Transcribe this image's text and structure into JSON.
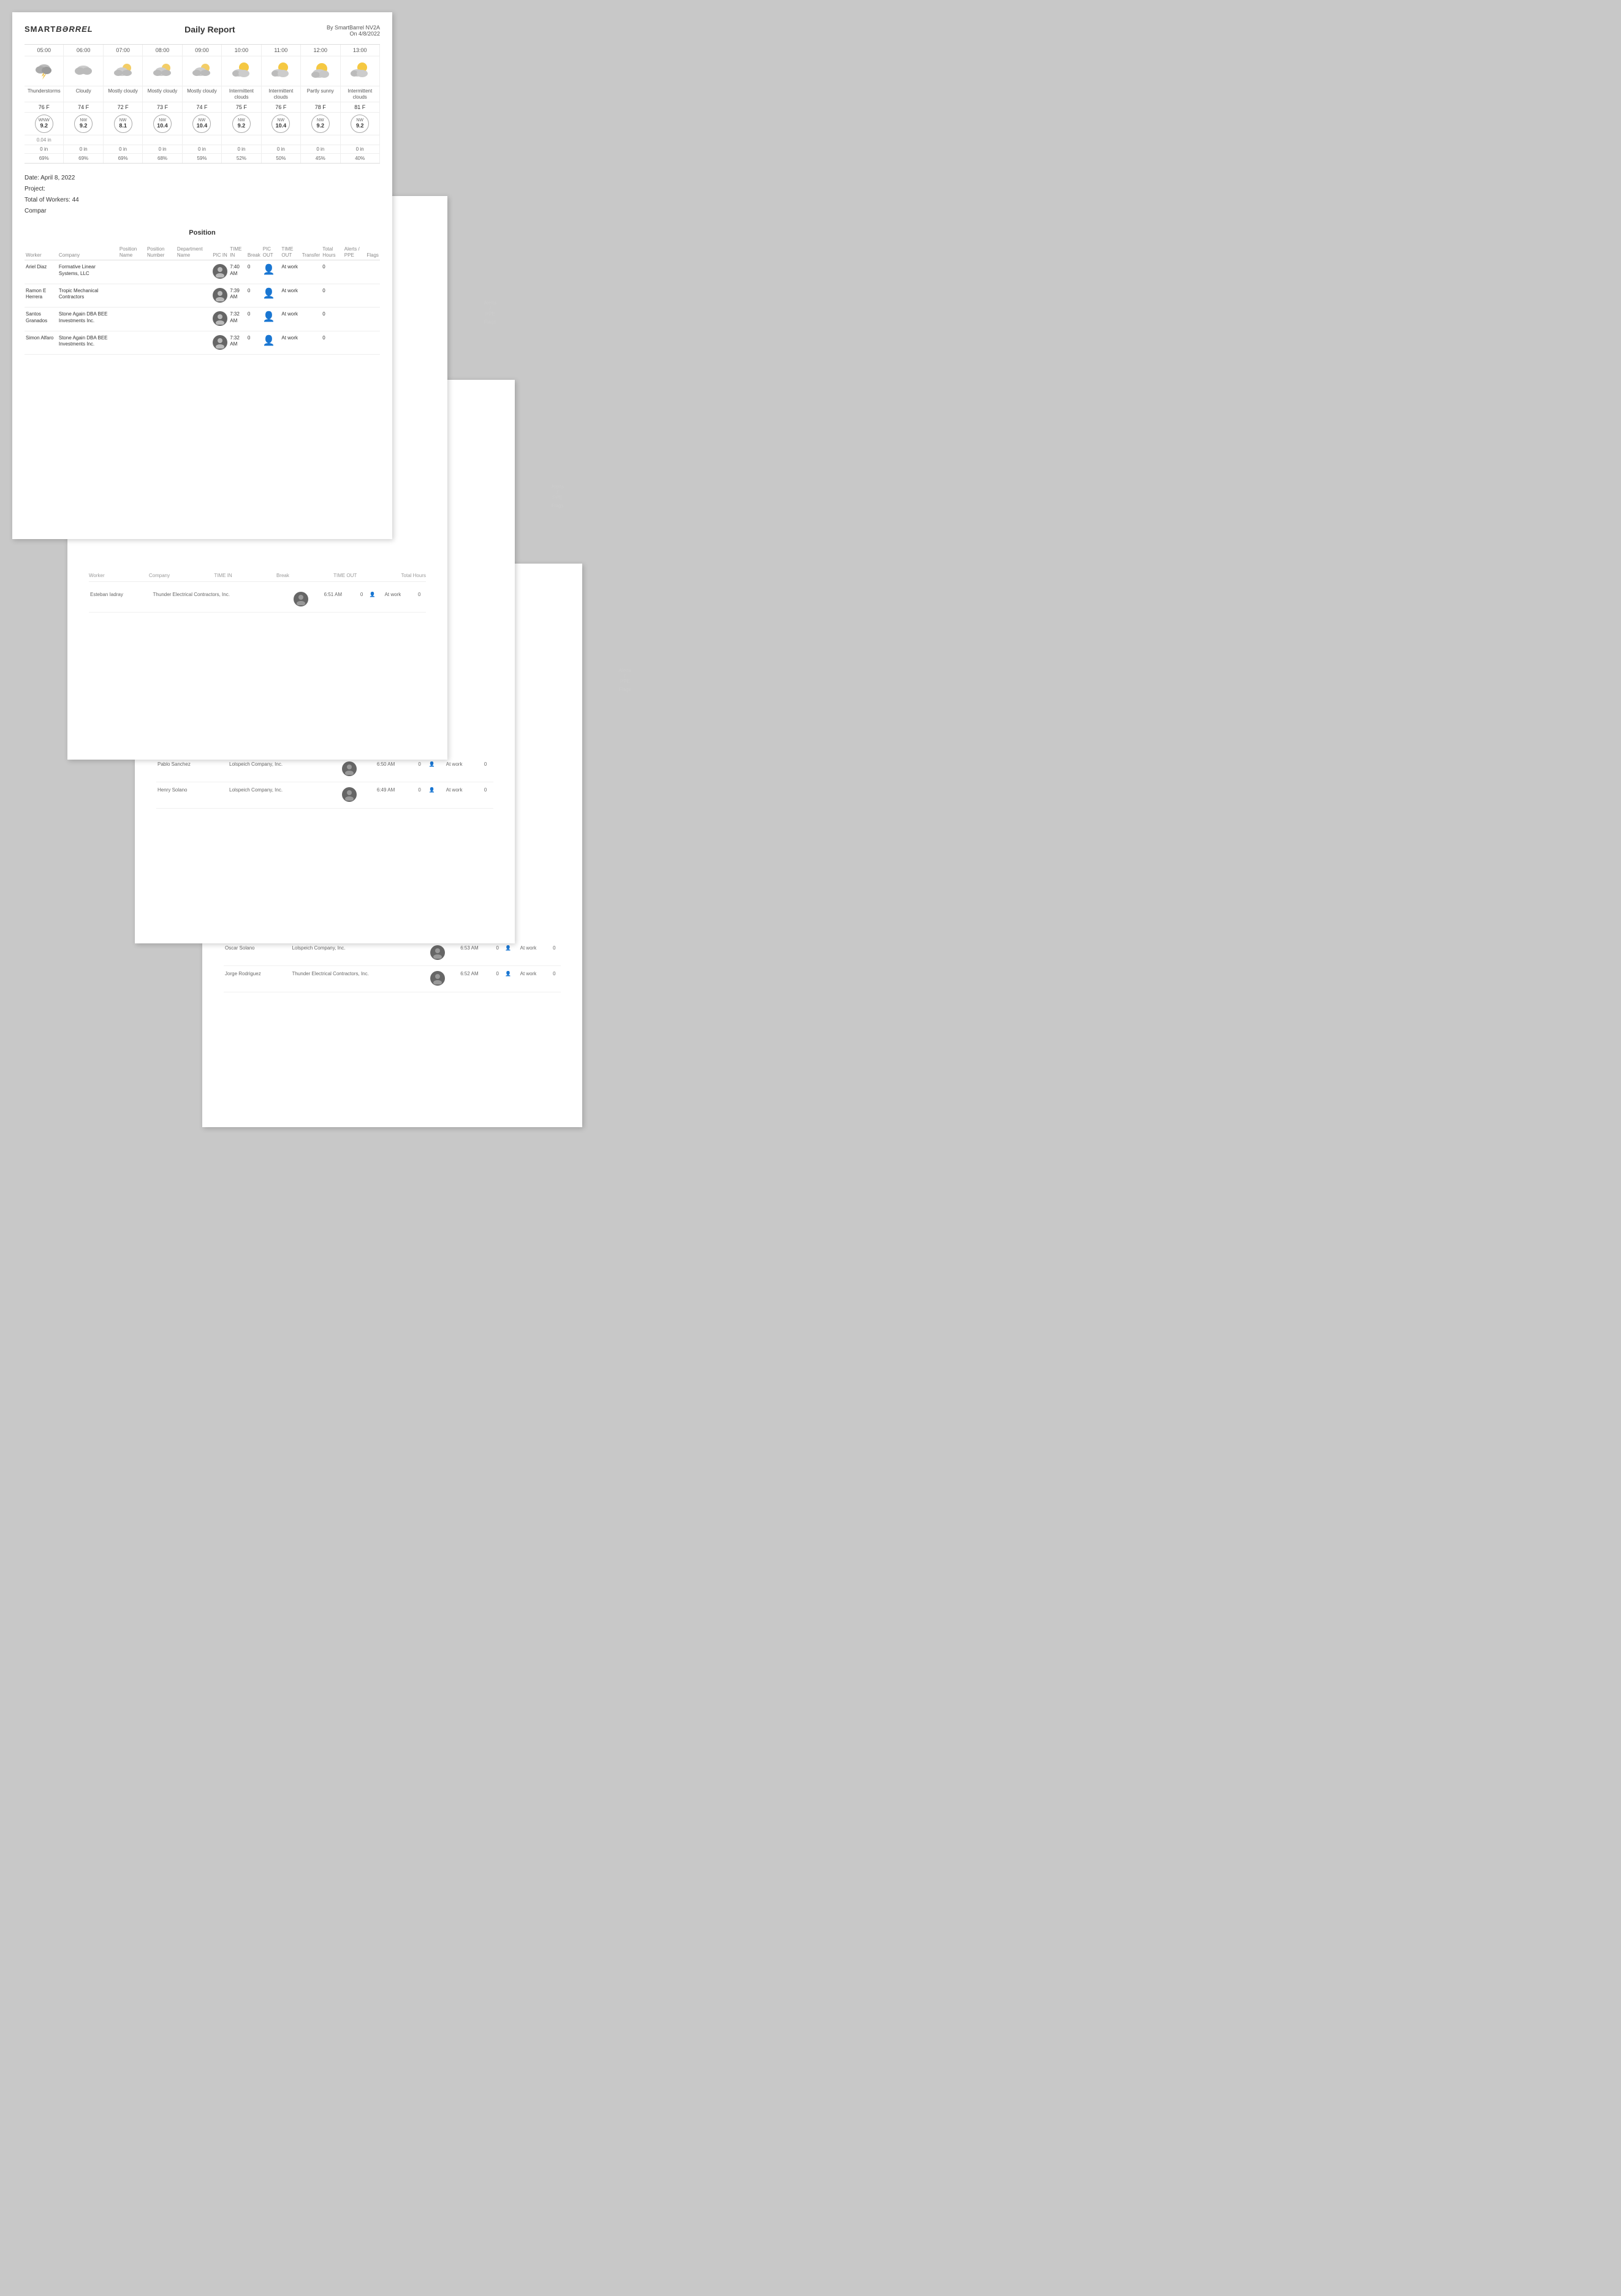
{
  "app": {
    "logo": "SMART",
    "logo_accent": "BƏRREL",
    "report_title": "Daily Report",
    "generated_by": "By SmartBarrel NV2A",
    "generated_on": "On 4/8/2022"
  },
  "weather": {
    "times": [
      "05:00",
      "06:00",
      "07:00",
      "08:00",
      "09:00",
      "10:00",
      "11:00",
      "12:00",
      "13:00"
    ],
    "conditions": [
      "Thunderstorms",
      "Cloudy",
      "Mostly cloudy",
      "Mostly cloudy",
      "Mostly cloudy",
      "Intermittent clouds",
      "Intermittent clouds",
      "Partly sunny",
      "Intermittent clouds"
    ],
    "temps": [
      "76 F",
      "74 F",
      "72 F",
      "73 F",
      "74 F",
      "75 F",
      "76 F",
      "78 F",
      "81 F"
    ],
    "wind_dirs": [
      "WNW",
      "NW",
      "NW",
      "NW",
      "NW",
      "NW",
      "NW",
      "NW",
      "NW"
    ],
    "wind_speeds": [
      "9.2",
      "9.2",
      "8.1",
      "10.4",
      "10.4",
      "9.2",
      "10.4",
      "9.2",
      "9.2"
    ],
    "precip_main": [
      "0.04 in",
      "",
      "",
      "",
      "",
      "",
      "",
      "",
      ""
    ],
    "precip_sub": [
      "0 in",
      "0 in",
      "0 in",
      "0 in",
      "0 in",
      "0 in",
      "0 in",
      "0 in",
      "0 in"
    ],
    "humidity": [
      "69%",
      "69%",
      "69%",
      "68%",
      "59%",
      "52%",
      "50%",
      "45%",
      "40%"
    ]
  },
  "report_info": {
    "date_label": "Date: April 8, 2022",
    "project_label": "Project:",
    "workers_label": "Total of Workers: 44",
    "company_label": "Compar"
  },
  "table": {
    "position_header": "Position",
    "columns": [
      "Worker",
      "Company",
      "Position Name",
      "Position Number",
      "Department Name",
      "PIC IN",
      "TIME IN",
      "Break",
      "PIC OUT",
      "TIME OUT",
      "Transfer",
      "Total Hours",
      "Alerts / PPE",
      "Flags"
    ],
    "rows": [
      {
        "worker": "Ariel Diaz",
        "company": "Formative Linear Systems, LLC",
        "position_name": "",
        "position_number": "",
        "department": "",
        "pic_in": "avatar",
        "time_in": "7:40 AM",
        "break": "0",
        "pic_out": "person",
        "time_out": "At work",
        "transfer": "",
        "total_hours": "0",
        "ppe": "",
        "flags": ""
      },
      {
        "worker": "Ramon E Herrera",
        "company": "Tropic Mechanical Contractors",
        "position_name": "",
        "position_number": "",
        "department": "",
        "pic_in": "avatar",
        "time_in": "7:39 AM",
        "break": "0",
        "pic_out": "person",
        "time_out": "At work",
        "transfer": "",
        "total_hours": "0",
        "ppe": "",
        "flags": ""
      },
      {
        "worker": "Santos Granados",
        "company": "Stone Again DBA BEE Investments Inc.",
        "position_name": "",
        "position_number": "",
        "department": "",
        "pic_in": "avatar",
        "time_in": "7:32 AM",
        "break": "0",
        "pic_out": "person",
        "time_out": "At work",
        "transfer": "",
        "total_hours": "0",
        "ppe": "",
        "flags": ""
      },
      {
        "worker": "Simon Alfaro",
        "company": "Stone Again DBA BEE Investments Inc.",
        "position_name": "",
        "position_number": "",
        "department": "",
        "pic_in": "avatar",
        "time_in": "7:32 AM",
        "break": "0",
        "pic_out": "person",
        "time_out": "At work",
        "transfer": "",
        "total_hours": "0",
        "ppe": "",
        "flags": ""
      }
    ]
  },
  "page2": {
    "rows": [
      {
        "worker": "Esteban Iadray",
        "company": "Thunder Electrical Contractors, Inc.",
        "time_in": "6:51 AM",
        "break": "0",
        "time_out": "At work",
        "total_hours": "0"
      }
    ]
  },
  "page3": {
    "rows": [
      {
        "worker": "Pablo Sanchez",
        "company": "Lolspeich Company, Inc.",
        "time_in": "6:50 AM",
        "break": "0",
        "time_out": "At work",
        "total_hours": "0"
      },
      {
        "worker": "Henry Solano",
        "company": "Lolspeich Company, Inc.",
        "time_in": "6:49 AM",
        "break": "0",
        "time_out": "At work",
        "total_hours": "0"
      }
    ]
  },
  "page4": {
    "rows": [
      {
        "worker": "Oscar Solano",
        "company": "Lolspeich Company, Inc.",
        "time_in": "6:53 AM",
        "break": "0",
        "time_out": "At work",
        "total_hours": "0"
      },
      {
        "worker": "Jorge Rodriguez",
        "company": "Thunder Electrical Contractors, Inc.",
        "time_in": "6:52 AM",
        "break": "0",
        "time_out": "At work",
        "total_hours": "0"
      }
    ]
  }
}
